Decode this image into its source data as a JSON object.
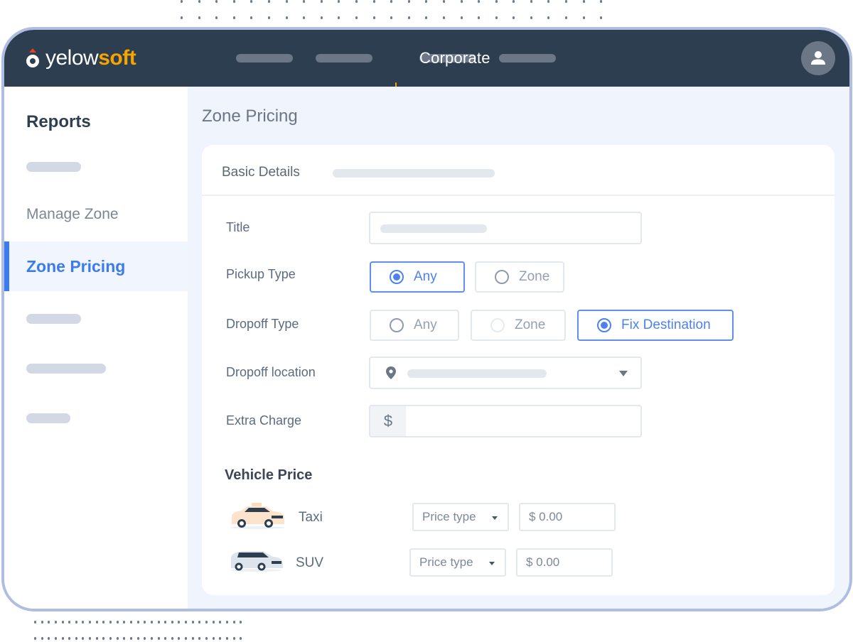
{
  "brand": {
    "name_part1": "yelow",
    "name_part2": "soft"
  },
  "topbar": {
    "active_tab": "Corporate",
    "tabs_placeholder_count": 4
  },
  "sidebar": {
    "title": "Reports",
    "items": [
      {
        "label": "",
        "placeholder": true
      },
      {
        "label": "Manage Zone",
        "placeholder": false
      },
      {
        "label": "Zone Pricing",
        "placeholder": false,
        "active": true
      },
      {
        "label": "",
        "placeholder": true
      },
      {
        "label": "",
        "placeholder": true
      },
      {
        "label": "",
        "placeholder": true
      }
    ]
  },
  "page": {
    "title": "Zone Pricing",
    "card_title": "Basic Details",
    "fields": {
      "title": {
        "label": "Title",
        "value": ""
      },
      "pickup_type": {
        "label": "Pickup Type",
        "options": [
          "Any",
          "Zone"
        ],
        "selected": "Any"
      },
      "dropoff_type": {
        "label": "Dropoff Type",
        "options": [
          "Any",
          "Zone",
          "Fix Destination"
        ],
        "selected": "Fix Destination"
      },
      "dropoff_location": {
        "label": "Dropoff location",
        "value": ""
      },
      "extra_charge": {
        "label": "Extra Charge",
        "currency": "$",
        "value": ""
      }
    },
    "vehicle_price": {
      "title": "Vehicle Price",
      "vehicles": [
        {
          "name": "Taxi",
          "price_type_placeholder": "Price type",
          "price_placeholder": "$ 0.00",
          "icon": "taxi-car-icon"
        },
        {
          "name": "SUV",
          "price_type_placeholder": "Price type",
          "price_placeholder": "$ 0.00",
          "icon": "suv-car-icon"
        }
      ]
    }
  },
  "colors": {
    "topbar": "#2d3e50",
    "accent_orange": "#f5a400",
    "accent_blue": "#3b7bef",
    "frame_border": "#afbde2",
    "main_bg": "#eff4fd"
  }
}
